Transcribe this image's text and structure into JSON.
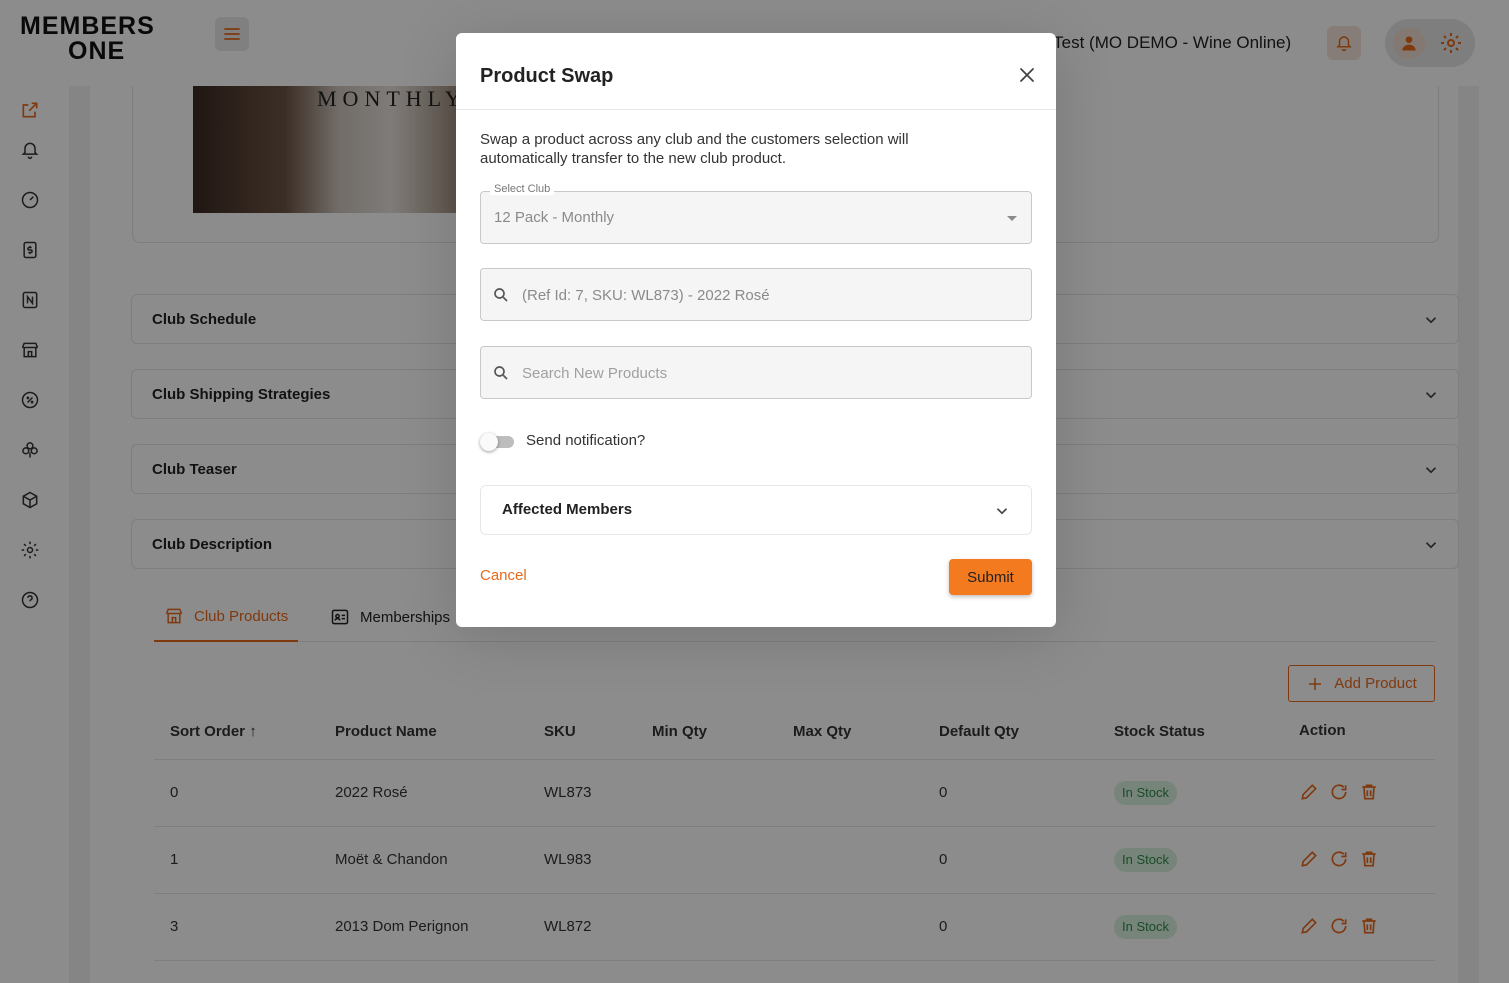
{
  "brand": {
    "logo_line1": "MEMBERS",
    "logo_line2": "ONE",
    "accent": "#e7691c"
  },
  "header": {
    "store_name": "t Test (MO DEMO - Wine Online)"
  },
  "banner": {
    "text": "MONTHLY"
  },
  "accordions": [
    {
      "title": "Club Schedule"
    },
    {
      "title": "Club Shipping Strategies"
    },
    {
      "title": "Club Teaser"
    },
    {
      "title": "Club Description"
    }
  ],
  "tabs": [
    {
      "label": "Club Products",
      "icon": "store-icon"
    },
    {
      "label": "Memberships",
      "icon": "id-card-icon"
    }
  ],
  "add_product_label": "Add Product",
  "table": {
    "headers": [
      "Sort Order",
      "Product Name",
      "SKU",
      "Min Qty",
      "Max Qty",
      "Default Qty",
      "Stock Status",
      "Action"
    ],
    "rows": [
      {
        "sort": "0",
        "name": "2022 Rosé",
        "sku": "WL873",
        "min": "",
        "max": "",
        "default": "0",
        "stock": "In Stock"
      },
      {
        "sort": "1",
        "name": "Moët & Chandon",
        "sku": "WL983",
        "min": "",
        "max": "",
        "default": "0",
        "stock": "In Stock"
      },
      {
        "sort": "3",
        "name": "2013 Dom Perignon",
        "sku": "WL872",
        "min": "",
        "max": "",
        "default": "0",
        "stock": "In Stock"
      }
    ]
  },
  "modal": {
    "title": "Product Swap",
    "description": "Swap a product across any club and the customers selection will automatically transfer to the new club product.",
    "select_label": "Select Club",
    "select_value": "12 Pack - Monthly",
    "current_product": "(Ref Id: 7, SKU: WL873) - 2022 Rosé",
    "new_product_placeholder": "Search New Products",
    "notify_label": "Send notification?",
    "notify_on": false,
    "affected_title": "Affected Members",
    "cancel_label": "Cancel",
    "submit_label": "Submit"
  }
}
